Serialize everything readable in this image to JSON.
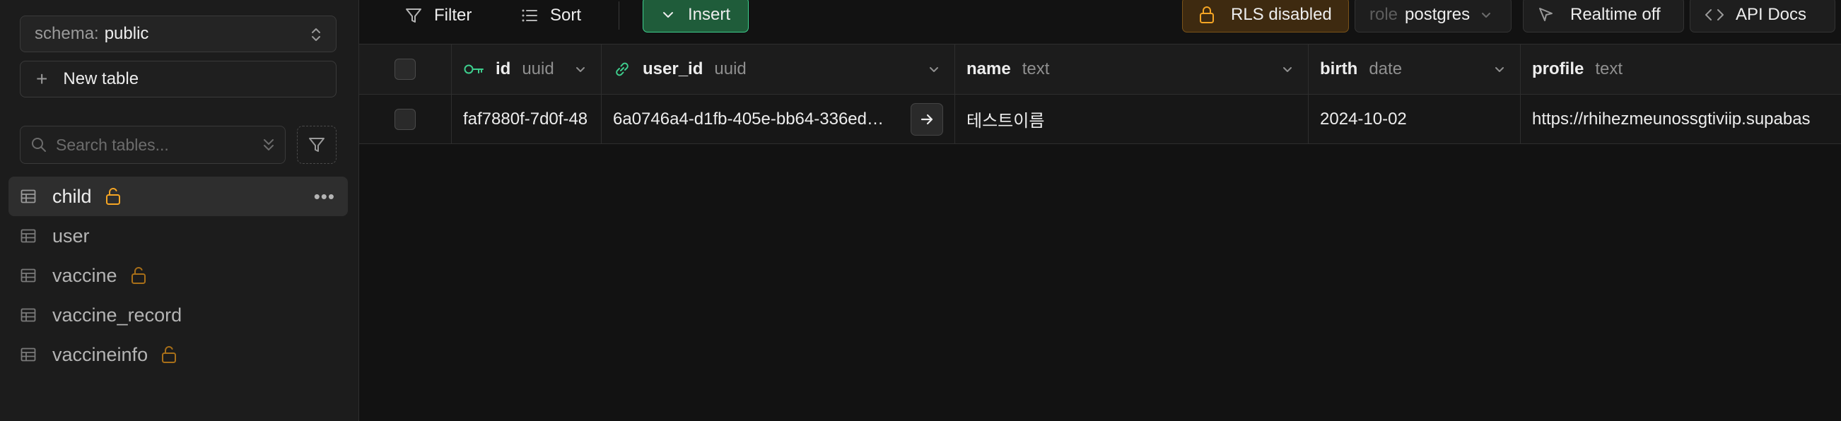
{
  "sidebar": {
    "schema_label": "schema:",
    "schema_value": "public",
    "new_table_label": "New table",
    "search_placeholder": "Search tables...",
    "tables": [
      {
        "name": "child",
        "rls_unlocked": true,
        "active": true
      },
      {
        "name": "user",
        "rls_unlocked": false,
        "active": false
      },
      {
        "name": "vaccine",
        "rls_unlocked": true,
        "active": false
      },
      {
        "name": "vaccine_record",
        "rls_unlocked": false,
        "active": false
      },
      {
        "name": "vaccineinfo",
        "rls_unlocked": true,
        "active": false
      }
    ]
  },
  "toolbar": {
    "filter_label": "Filter",
    "sort_label": "Sort",
    "insert_label": "Insert",
    "rls_label": "RLS disabled",
    "role_label": "role",
    "role_value": "postgres",
    "realtime_label": "Realtime off",
    "api_docs_label": "API Docs"
  },
  "grid": {
    "columns": [
      {
        "name": "id",
        "type": "uuid"
      },
      {
        "name": "user_id",
        "type": "uuid"
      },
      {
        "name": "name",
        "type": "text"
      },
      {
        "name": "birth",
        "type": "date"
      },
      {
        "name": "profile",
        "type": "text"
      }
    ],
    "rows": [
      {
        "id": "faf7880f-7d0f-48",
        "user_id": "6a0746a4-d1fb-405e-bb64-336ed…",
        "name": "테스트이름",
        "birth": "2024-10-02",
        "profile": "https://rhihezmeunossgtiviip.supabas"
      }
    ]
  },
  "colors": {
    "background": "#121212",
    "sidebar": "#1c1c1c",
    "brand_green": "#3ecf8e",
    "warning_amber": "#f5a524"
  },
  "icons": [
    "chevron-up-down-icon",
    "plus-icon",
    "search-icon",
    "double-chevron-icon",
    "filter-icon",
    "table-icon",
    "unlock-icon",
    "more-icon",
    "sort-icon",
    "chevron-down-icon",
    "lock-icon",
    "realtime-icon",
    "code-icon",
    "key-icon",
    "link-icon",
    "arrow-right-icon"
  ]
}
